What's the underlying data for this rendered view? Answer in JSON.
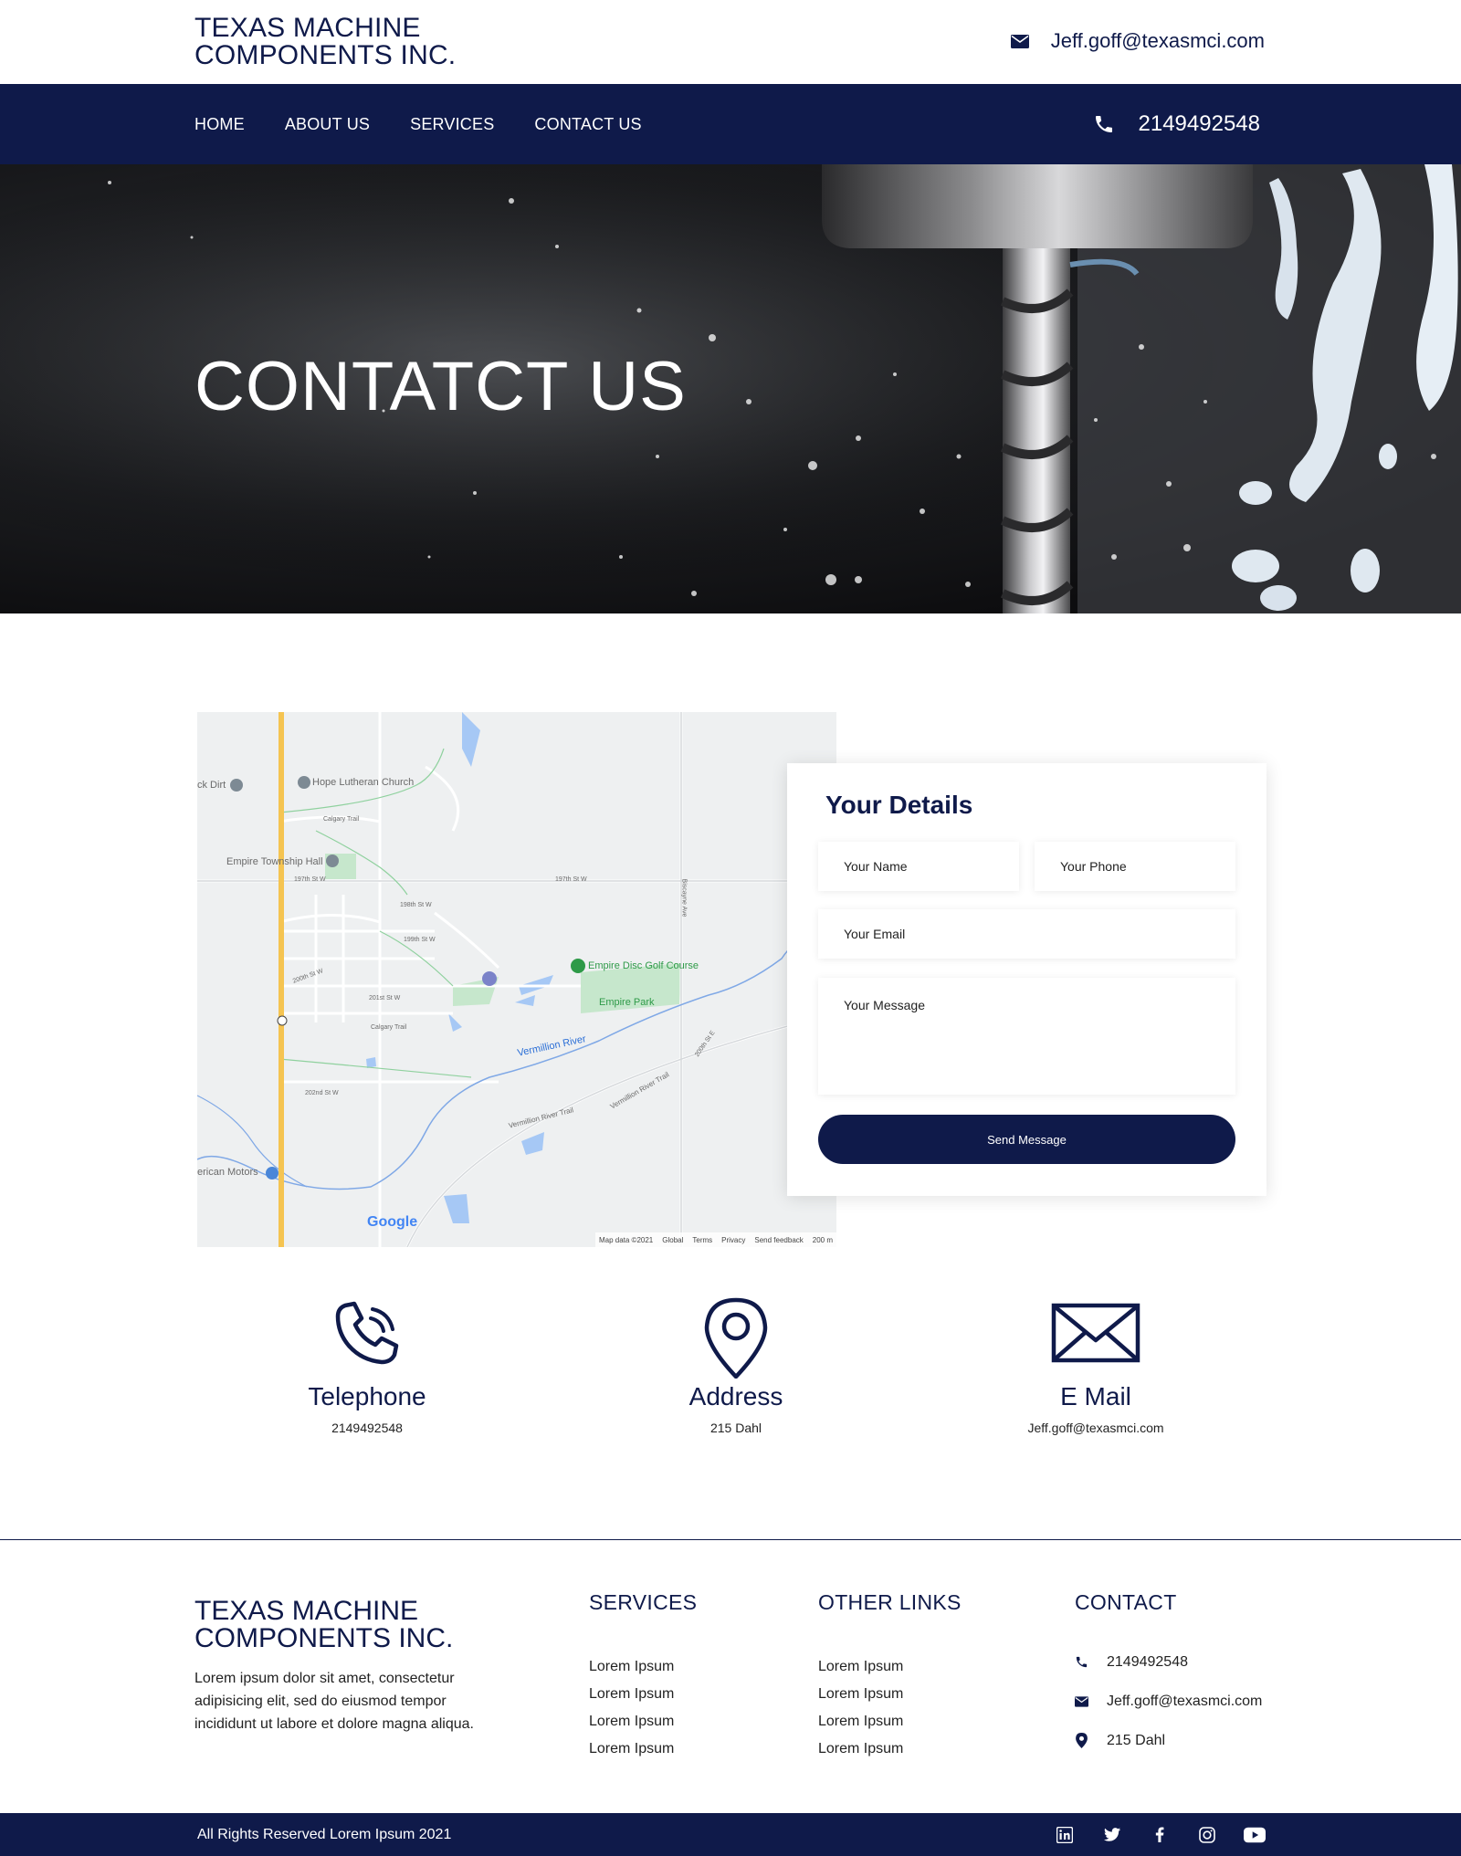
{
  "brand": {
    "line1": "TEXAS MACHINE",
    "line2": "COMPONENTS INC."
  },
  "header": {
    "email": "Jeff.goff@texasmci.com",
    "email_icon": "envelope-icon"
  },
  "nav": {
    "items": [
      "HOME",
      "ABOUT US",
      "SERVICES",
      "CONTACT US"
    ],
    "phone": "2149492548",
    "phone_icon": "phone-icon"
  },
  "hero": {
    "title": "CONTATCT US"
  },
  "map": {
    "labels": {
      "church": "Hope Lutheran Church",
      "hall": "Empire Township Hall",
      "dirt": "ck Dirt",
      "golf": "Empire Disc Golf Course",
      "park": "Empire Park",
      "river": "Vermillion River",
      "trail": "Vermillion River Trail",
      "trail2": "Vermillion River Trail",
      "motors": "erican Motors",
      "st197": "197th St W",
      "st197b": "197th St W",
      "st198": "198th St W",
      "st199": "199th St W",
      "st200": "200th St W",
      "st201": "201st St W",
      "st202": "202nd St W",
      "st200e": "200th St E",
      "calgary": "Calgary Trail",
      "calgary2": "Calgary Trail",
      "biscayne": "Biscayne Ave",
      "google": "Google"
    },
    "footer": [
      "Map data ©2021",
      "Global",
      "Terms",
      "Privacy",
      "Send feedback",
      "200 m"
    ]
  },
  "form": {
    "title": "Your Details",
    "name_placeholder": "Your Name",
    "phone_placeholder": "Your Phone",
    "email_placeholder": "Your Email",
    "message_placeholder": "Your Message",
    "submit": "Send Message"
  },
  "contact_info": [
    {
      "icon": "phone-ringing-icon",
      "title": "Telephone",
      "value": "2149492548"
    },
    {
      "icon": "location-pin-icon",
      "title": "Address",
      "value": "215 Dahl"
    },
    {
      "icon": "envelope-icon",
      "title": "E Mail",
      "value": "Jeff.goff@texasmci.com"
    }
  ],
  "footer": {
    "brand_line1": "TEXAS MACHINE",
    "brand_line2": "COMPONENTS INC.",
    "about": "Lorem ipsum dolor sit amet, consectetur adipisicing elit, sed do eiusmod tempor incididunt ut labore et dolore magna aliqua.",
    "services": {
      "title": "SERVICES",
      "links": [
        "Lorem Ipsum",
        "Lorem Ipsum",
        "Lorem Ipsum",
        "Lorem Ipsum"
      ]
    },
    "other_links": {
      "title": "OTHER LINKS",
      "links": [
        "Lorem Ipsum",
        "Lorem Ipsum",
        "Lorem Ipsum",
        "Lorem Ipsum"
      ]
    },
    "contact": {
      "title": "CONTACT",
      "phone": "2149492548",
      "email": "Jeff.goff@texasmci.com",
      "address": "215 Dahl"
    },
    "copyright": "All Rights Reserved Lorem Ipsum 2021",
    "socials": [
      "linkedin-icon",
      "twitter-icon",
      "facebook-icon",
      "instagram-icon",
      "youtube-icon"
    ]
  },
  "colors": {
    "navy": "#0f1a4a",
    "white": "#ffffff"
  }
}
